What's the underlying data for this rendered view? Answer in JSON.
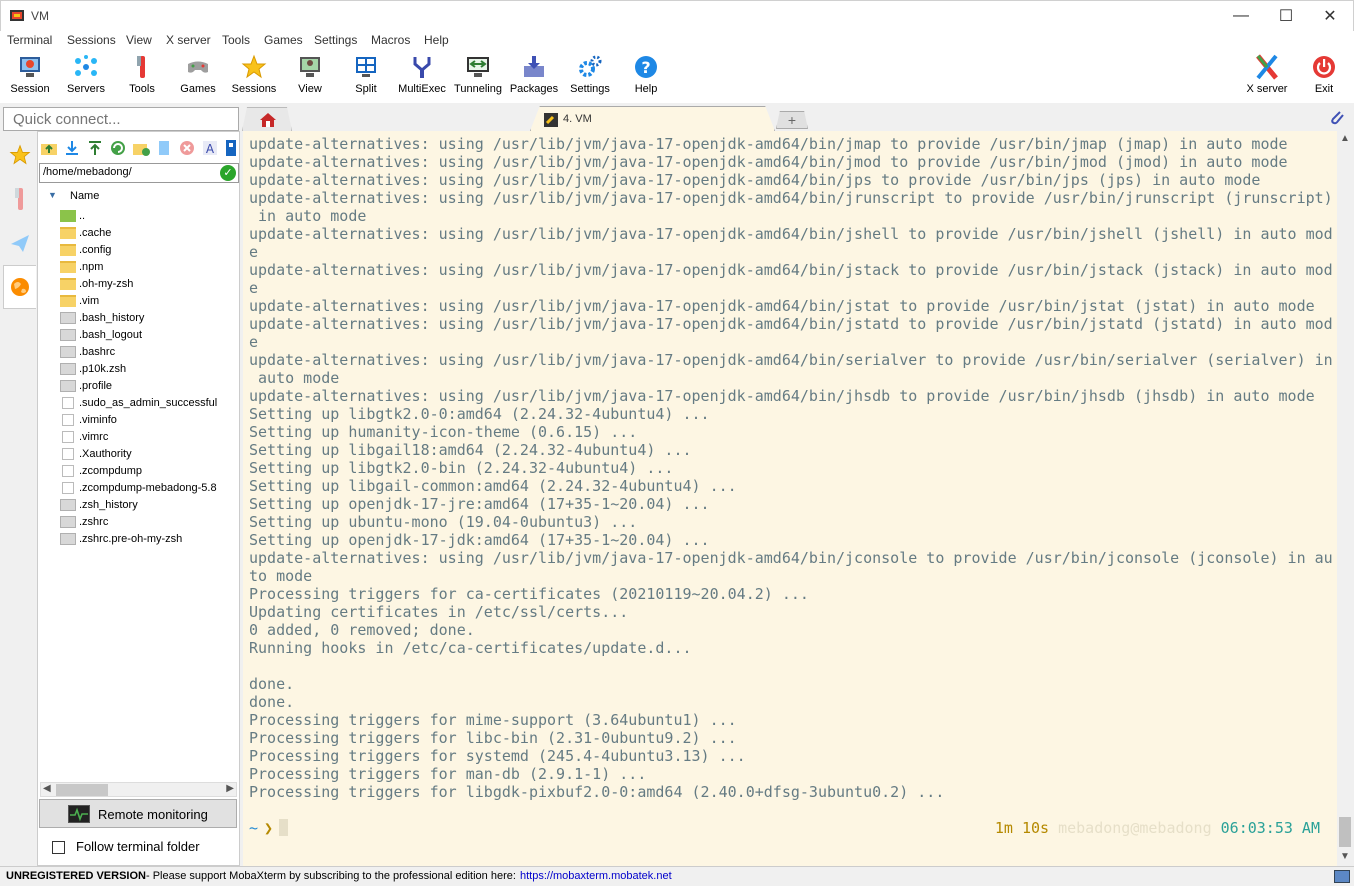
{
  "window": {
    "title": "VM"
  },
  "menu": [
    "Terminal",
    "Sessions",
    "View",
    "X server",
    "Tools",
    "Games",
    "Settings",
    "Macros",
    "Help"
  ],
  "toolbar": {
    "session": "Session",
    "servers": "Servers",
    "tools": "Tools",
    "games": "Games",
    "sessions": "Sessions",
    "view": "View",
    "split": "Split",
    "multiexec": "MultiExec",
    "tunneling": "Tunneling",
    "packages": "Packages",
    "settings": "Settings",
    "help": "Help",
    "xserver": "X server",
    "exit": "Exit"
  },
  "tabs": {
    "quick_connect_placeholder": "Quick connect...",
    "active_tab": "4. VM"
  },
  "sftp": {
    "path": "/home/mebadong/",
    "column_name": "Name",
    "files": [
      "..",
      ".cache",
      ".config",
      ".npm",
      ".oh-my-zsh",
      ".vim",
      ".bash_history",
      ".bash_logout",
      ".bashrc",
      ".p10k.zsh",
      ".profile",
      ".sudo_as_admin_successful",
      ".viminfo",
      ".vimrc",
      ".Xauthority",
      ".zcompdump",
      ".zcompdump-mebadong-5.8",
      ".zsh_history",
      ".zshrc",
      ".zshrc.pre-oh-my-zsh"
    ],
    "remote_monitoring": "Remote monitoring",
    "follow_terminal": "Follow terminal folder"
  },
  "terminal": {
    "lines": [
      "update-alternatives: using /usr/lib/jvm/java-17-openjdk-amd64/bin/jmap to provide /usr/bin/jmap (jmap) in auto mode",
      "update-alternatives: using /usr/lib/jvm/java-17-openjdk-amd64/bin/jmod to provide /usr/bin/jmod (jmod) in auto mode",
      "update-alternatives: using /usr/lib/jvm/java-17-openjdk-amd64/bin/jps to provide /usr/bin/jps (jps) in auto mode",
      "update-alternatives: using /usr/lib/jvm/java-17-openjdk-amd64/bin/jrunscript to provide /usr/bin/jrunscript (jrunscript)",
      " in auto mode",
      "update-alternatives: using /usr/lib/jvm/java-17-openjdk-amd64/bin/jshell to provide /usr/bin/jshell (jshell) in auto mod",
      "e",
      "update-alternatives: using /usr/lib/jvm/java-17-openjdk-amd64/bin/jstack to provide /usr/bin/jstack (jstack) in auto mod",
      "e",
      "update-alternatives: using /usr/lib/jvm/java-17-openjdk-amd64/bin/jstat to provide /usr/bin/jstat (jstat) in auto mode",
      "update-alternatives: using /usr/lib/jvm/java-17-openjdk-amd64/bin/jstatd to provide /usr/bin/jstatd (jstatd) in auto mod",
      "e",
      "update-alternatives: using /usr/lib/jvm/java-17-openjdk-amd64/bin/serialver to provide /usr/bin/serialver (serialver) in",
      " auto mode",
      "update-alternatives: using /usr/lib/jvm/java-17-openjdk-amd64/bin/jhsdb to provide /usr/bin/jhsdb (jhsdb) in auto mode",
      "Setting up libgtk2.0-0:amd64 (2.24.32-4ubuntu4) ...",
      "Setting up humanity-icon-theme (0.6.15) ...",
      "Setting up libgail18:amd64 (2.24.32-4ubuntu4) ...",
      "Setting up libgtk2.0-bin (2.24.32-4ubuntu4) ...",
      "Setting up libgail-common:amd64 (2.24.32-4ubuntu4) ...",
      "Setting up openjdk-17-jre:amd64 (17+35-1~20.04) ...",
      "Setting up ubuntu-mono (19.04-0ubuntu3) ...",
      "Setting up openjdk-17-jdk:amd64 (17+35-1~20.04) ...",
      "update-alternatives: using /usr/lib/jvm/java-17-openjdk-amd64/bin/jconsole to provide /usr/bin/jconsole (jconsole) in au",
      "to mode",
      "Processing triggers for ca-certificates (20210119~20.04.2) ...",
      "Updating certificates in /etc/ssl/certs...",
      "0 added, 0 removed; done.",
      "Running hooks in /etc/ca-certificates/update.d...",
      "",
      "done.",
      "done.",
      "Processing triggers for mime-support (3.64ubuntu1) ...",
      "Processing triggers for libc-bin (2.31-0ubuntu9.2) ...",
      "Processing triggers for systemd (245.4-4ubuntu3.13) ...",
      "Processing triggers for man-db (2.9.1-1) ...",
      "Processing triggers for libgdk-pixbuf2.0-0:amd64 (2.40.0+dfsg-3ubuntu0.2) ..."
    ],
    "prompt_tilde": "~",
    "prompt_arrow": "❯",
    "elapsed": "1m 10s",
    "user_host": "mebadong@mebadong",
    "clock": "06:03:53 AM"
  },
  "status": {
    "bold": "UNREGISTERED VERSION",
    "message": " -  Please support MobaXterm by subscribing to the professional edition here:",
    "link": "https://mobaxterm.mobatek.net"
  },
  "colors": {
    "terminal_bg": "#fdf6e3",
    "terminal_fg": "#657b83",
    "accent_blue": "#268bd2",
    "yellow": "#b58900",
    "cyan": "#2aa198"
  }
}
